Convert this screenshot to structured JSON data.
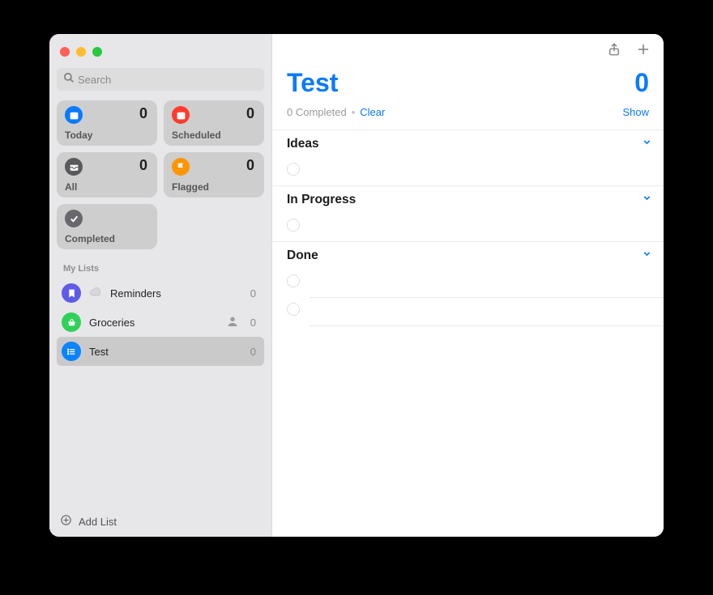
{
  "search": {
    "placeholder": "Search"
  },
  "smart": {
    "today": {
      "label": "Today",
      "count": "0"
    },
    "scheduled": {
      "label": "Scheduled",
      "count": "0"
    },
    "all": {
      "label": "All",
      "count": "0"
    },
    "flagged": {
      "label": "Flagged",
      "count": "0"
    },
    "completed": {
      "label": "Completed"
    }
  },
  "mylists": {
    "header": "My Lists",
    "items": [
      {
        "name": "Reminders",
        "count": "0"
      },
      {
        "name": "Groceries",
        "count": "0"
      },
      {
        "name": "Test",
        "count": "0"
      }
    ]
  },
  "footer": {
    "addList": "Add List"
  },
  "detail": {
    "title": "Test",
    "count": "0",
    "completedText": "0 Completed",
    "clear": "Clear",
    "show": "Show",
    "sections": [
      {
        "name": "Ideas"
      },
      {
        "name": "In Progress"
      },
      {
        "name": "Done"
      }
    ]
  }
}
